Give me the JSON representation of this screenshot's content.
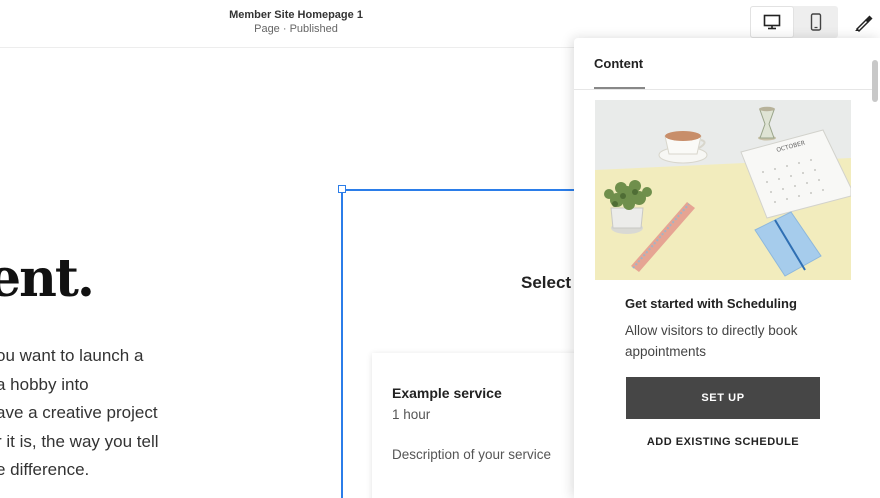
{
  "header": {
    "page_title": "Member Site Homepage 1",
    "page_status": "Page · Published",
    "icons": {
      "desktop": "desktop-icon",
      "mobile": "mobile-icon",
      "design": "paintbrush-icon"
    }
  },
  "canvas": {
    "hero_heading": "ent.",
    "hero_lines": [
      "ou want to launch a",
      "a hobby into",
      "ave a creative project",
      "r it is, the way you tell",
      "e difference."
    ],
    "select_text": "Select A",
    "service": {
      "name": "Example service",
      "duration": "1 hour",
      "description": "Description of your service"
    }
  },
  "panel": {
    "tab_label": "Content",
    "calendar_month": "OCTOBER",
    "heading": "Get started with Scheduling",
    "description": "Allow visitors to directly book appointments",
    "setup_label": "SET UP",
    "existing_label": "ADD EXISTING SCHEDULE"
  },
  "colors": {
    "accent_blue": "#2b7de9",
    "button_dark": "#464646",
    "image_bg": "#f2ecbd"
  }
}
